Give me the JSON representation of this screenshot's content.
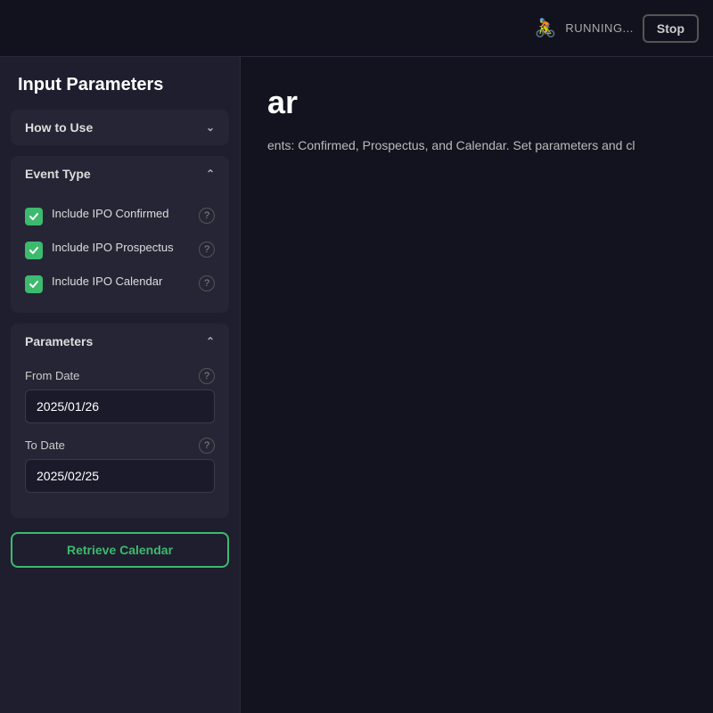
{
  "header": {
    "status_label": "RUNNING...",
    "stop_label": "Stop",
    "bike_icon": "🚴"
  },
  "sidebar": {
    "title": "Input Parameters",
    "how_to_use": {
      "label": "How to Use",
      "expanded": false
    },
    "event_type": {
      "label": "Event Type",
      "expanded": true,
      "items": [
        {
          "label": "Include IPO Confirmed",
          "checked": true
        },
        {
          "label": "Include IPO Prospectus",
          "checked": true
        },
        {
          "label": "Include IPO Calendar",
          "checked": true
        }
      ]
    },
    "parameters": {
      "label": "Parameters",
      "expanded": true,
      "from_date": {
        "label": "From Date",
        "value": "2025/01/26"
      },
      "to_date": {
        "label": "To Date",
        "value": "2025/02/25"
      }
    },
    "retrieve_button": "Retrieve Calendar"
  },
  "content": {
    "title": "ar",
    "description": "ents: Confirmed, Prospectus, and Calendar. Set parameters and cl"
  }
}
